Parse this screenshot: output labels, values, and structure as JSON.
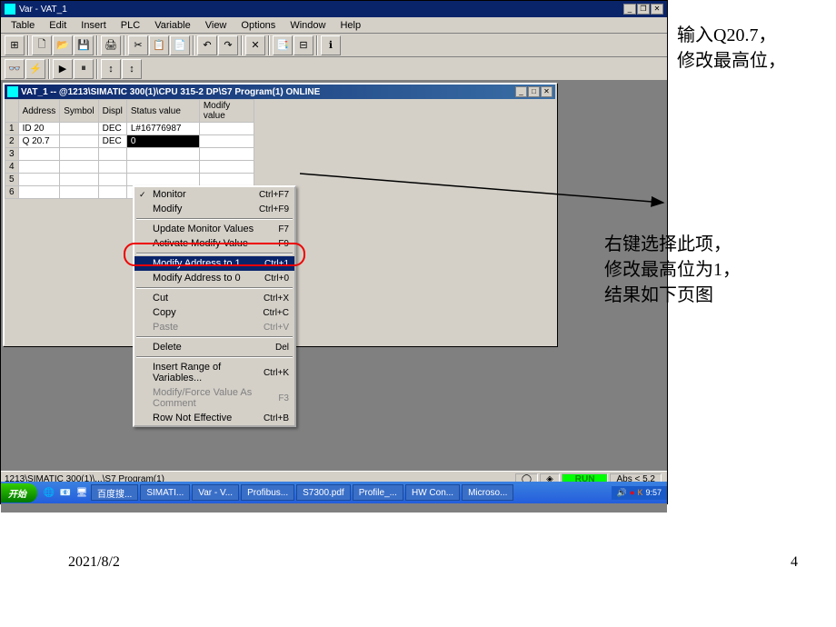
{
  "window": {
    "title": "Var - VAT_1"
  },
  "menu": {
    "items": [
      "Table",
      "Edit",
      "Insert",
      "PLC",
      "Variable",
      "View",
      "Options",
      "Window",
      "Help"
    ]
  },
  "doc": {
    "title": "VAT_1 -- @1213\\SIMATIC 300(1)\\CPU 315-2 DP\\S7 Program(1)  ONLINE"
  },
  "grid": {
    "headers": [
      "",
      "Address",
      "Symbol",
      "Displ",
      "Status value",
      "Modify value"
    ],
    "rows": [
      {
        "n": "1",
        "addr": "ID   20",
        "sym": "",
        "disp": "DEC",
        "status": "L#16776987",
        "modify": ""
      },
      {
        "n": "2",
        "addr": "Q    20.7",
        "sym": "",
        "disp": "DEC",
        "status": "0",
        "modify": ""
      },
      {
        "n": "3",
        "addr": "",
        "sym": "",
        "disp": "",
        "status": "",
        "modify": ""
      },
      {
        "n": "4",
        "addr": "",
        "sym": "",
        "disp": "",
        "status": "",
        "modify": ""
      },
      {
        "n": "5",
        "addr": "",
        "sym": "",
        "disp": "",
        "status": "",
        "modify": ""
      },
      {
        "n": "6",
        "addr": "",
        "sym": "",
        "disp": "",
        "status": "",
        "modify": ""
      }
    ]
  },
  "context": {
    "items": [
      {
        "label": "Monitor",
        "sc": "Ctrl+F7",
        "chk": true
      },
      {
        "label": "Modify",
        "sc": "Ctrl+F9"
      },
      {
        "sep": true
      },
      {
        "label": "Update Monitor Values",
        "sc": "F7"
      },
      {
        "label": "Activate Modify Value",
        "sc": "F9"
      },
      {
        "sep": true
      },
      {
        "label": "Modify Address to 1",
        "sc": "Ctrl+1",
        "hl": true
      },
      {
        "label": "Modify Address to 0",
        "sc": "Ctrl+0"
      },
      {
        "sep": true
      },
      {
        "label": "Cut",
        "sc": "Ctrl+X"
      },
      {
        "label": "Copy",
        "sc": "Ctrl+C"
      },
      {
        "label": "Paste",
        "sc": "Ctrl+V",
        "dis": true
      },
      {
        "sep": true
      },
      {
        "label": "Delete",
        "sc": "Del"
      },
      {
        "sep": true
      },
      {
        "label": "Insert Range of Variables...",
        "sc": "Ctrl+K"
      },
      {
        "label": "Modify/Force Value As Comment",
        "sc": "F3",
        "dis": true
      },
      {
        "label": "Row Not Effective",
        "sc": "Ctrl+B"
      }
    ]
  },
  "status": {
    "path": "1213\\SIMATIC 300(1)\\...\\S7 Program(1)",
    "run": "RUN",
    "abs": "Abs < 5.2"
  },
  "taskbar": {
    "start": "开始",
    "items": [
      "百度搜...",
      "SIMATI...",
      "Var - V...",
      "Profibus...",
      "S7300.pdf",
      "Profile_...",
      "HW Con...",
      "Microso..."
    ],
    "time": "9:57"
  },
  "annotations": {
    "a1": "输入Q20.7，\n修改最高位，",
    "a2": "右键选择此项，\n修改最高位为1，\n结果如下页图"
  },
  "footer": {
    "date": "2021/8/2",
    "page": "4"
  }
}
